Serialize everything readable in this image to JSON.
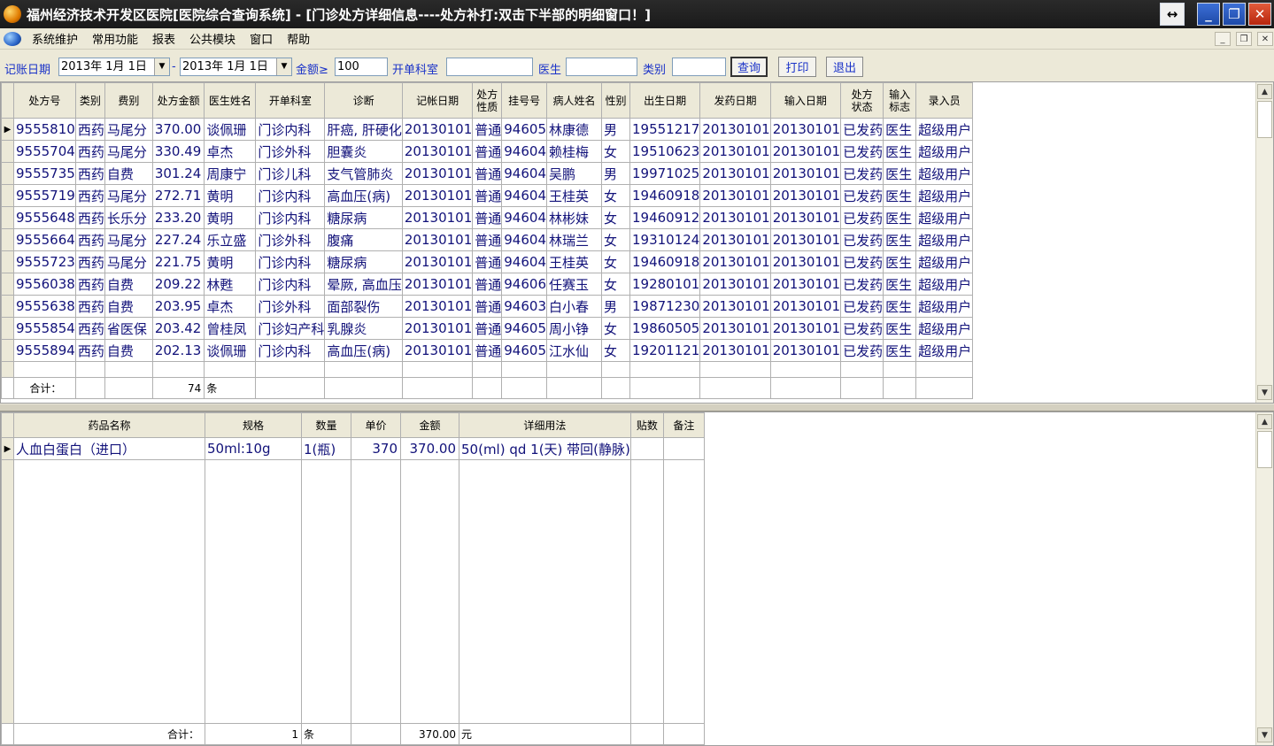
{
  "window": {
    "title": "福州经济技术开发区医院[医院综合查询系统] - [门诊处方详细信息----处方补打:双击下半部的明细窗口！]"
  },
  "menu": [
    "系统维护",
    "常用功能",
    "报表",
    "公共模块",
    "窗口",
    "帮助"
  ],
  "filter": {
    "date_label": "记账日期",
    "date_from": "2013年 1月 1日",
    "date_sep": "-",
    "date_to": "2013年 1月 1日",
    "amount_label": "金额≥",
    "amount_value": "100",
    "dept_label": "开单科室",
    "dept_value": "",
    "doctor_label": "医生",
    "doctor_value": "",
    "type_label": "类别",
    "type_value": "",
    "query_button": "查询",
    "print_button": "打印",
    "exit_button": "退出"
  },
  "top_grid": {
    "columns": [
      "处方号",
      "类别",
      "费别",
      "处方金额",
      "医生姓名",
      "开单科室",
      "诊断",
      "记帐日期",
      "处方\n性质",
      "挂号号",
      "病人姓名",
      "性别",
      "出生日期",
      "发药日期",
      "输入日期",
      "处方\n状态",
      "输入\n标志",
      "录入员"
    ],
    "rows": [
      [
        "9555810",
        "西药",
        "马尾分",
        "370.00",
        "谈佩珊",
        "门诊内科",
        "肝癌, 肝硬化",
        "20130101",
        "普通",
        "94605",
        "林康德",
        "男",
        "19551217",
        "20130101",
        "20130101",
        "已发药",
        "医生",
        "超级用户"
      ],
      [
        "9555704",
        "西药",
        "马尾分",
        "330.49",
        "卓杰",
        "门诊外科",
        "胆囊炎",
        "20130101",
        "普通",
        "94604",
        "赖桂梅",
        "女",
        "19510623",
        "20130101",
        "20130101",
        "已发药",
        "医生",
        "超级用户"
      ],
      [
        "9555735",
        "西药",
        "自费",
        "301.24",
        "周康宁",
        "门诊儿科",
        "支气管肺炎",
        "20130101",
        "普通",
        "94604",
        "吴鹏",
        "男",
        "19971025",
        "20130101",
        "20130101",
        "已发药",
        "医生",
        "超级用户"
      ],
      [
        "9555719",
        "西药",
        "马尾分",
        "272.71",
        "黄明",
        "门诊内科",
        "高血压(病)",
        "20130101",
        "普通",
        "94604",
        "王桂英",
        "女",
        "19460918",
        "20130101",
        "20130101",
        "已发药",
        "医生",
        "超级用户"
      ],
      [
        "9555648",
        "西药",
        "长乐分",
        "233.20",
        "黄明",
        "门诊内科",
        "糖尿病",
        "20130101",
        "普通",
        "94604",
        "林彬妹",
        "女",
        "19460912",
        "20130101",
        "20130101",
        "已发药",
        "医生",
        "超级用户"
      ],
      [
        "9555664",
        "西药",
        "马尾分",
        "227.24",
        "乐立盛",
        "门诊外科",
        "腹痛",
        "20130101",
        "普通",
        "94604",
        "林瑞兰",
        "女",
        "19310124",
        "20130101",
        "20130101",
        "已发药",
        "医生",
        "超级用户"
      ],
      [
        "9555723",
        "西药",
        "马尾分",
        "221.75",
        "黄明",
        "门诊内科",
        "糖尿病",
        "20130101",
        "普通",
        "94604",
        "王桂英",
        "女",
        "19460918",
        "20130101",
        "20130101",
        "已发药",
        "医生",
        "超级用户"
      ],
      [
        "9556038",
        "西药",
        "自费",
        "209.22",
        "林甦",
        "门诊内科",
        "晕厥, 高血压",
        "20130101",
        "普通",
        "94606",
        "任赛玉",
        "女",
        "19280101",
        "20130101",
        "20130101",
        "已发药",
        "医生",
        "超级用户"
      ],
      [
        "9555638",
        "西药",
        "自费",
        "203.95",
        "卓杰",
        "门诊外科",
        "面部裂伤",
        "20130101",
        "普通",
        "94603",
        "白小春",
        "男",
        "19871230",
        "20130101",
        "20130101",
        "已发药",
        "医生",
        "超级用户"
      ],
      [
        "9555854",
        "西药",
        "省医保",
        "203.42",
        "曾桂凤",
        "门诊妇产科",
        "乳腺炎",
        "20130101",
        "普通",
        "94605",
        "周小铮",
        "女",
        "19860505",
        "20130101",
        "20130101",
        "已发药",
        "医生",
        "超级用户"
      ],
      [
        "9555894",
        "西药",
        "自费",
        "202.13",
        "谈佩珊",
        "门诊内科",
        "高血压(病)",
        "20130101",
        "普通",
        "94605",
        "江水仙",
        "女",
        "19201121",
        "20130101",
        "20130101",
        "已发药",
        "医生",
        "超级用户"
      ]
    ],
    "sum_label": "合计：",
    "sum_count": "74",
    "sum_unit": "条"
  },
  "bottom_grid": {
    "columns": [
      "药品名称",
      "规格",
      "数量",
      "单价",
      "金额",
      "详细用法",
      "贴数",
      "备注"
    ],
    "rows": [
      [
        "人血白蛋白（进口）",
        "50ml:10g",
        "1(瓶)",
        "370",
        "370.00",
        "50(ml) qd 1(天) 带回(静脉)",
        "",
        ""
      ]
    ],
    "sum_label": "合计：",
    "sum_count": "1",
    "sum_unit": "条",
    "sum_amount": "370.00",
    "sum_amount_unit": "元"
  }
}
